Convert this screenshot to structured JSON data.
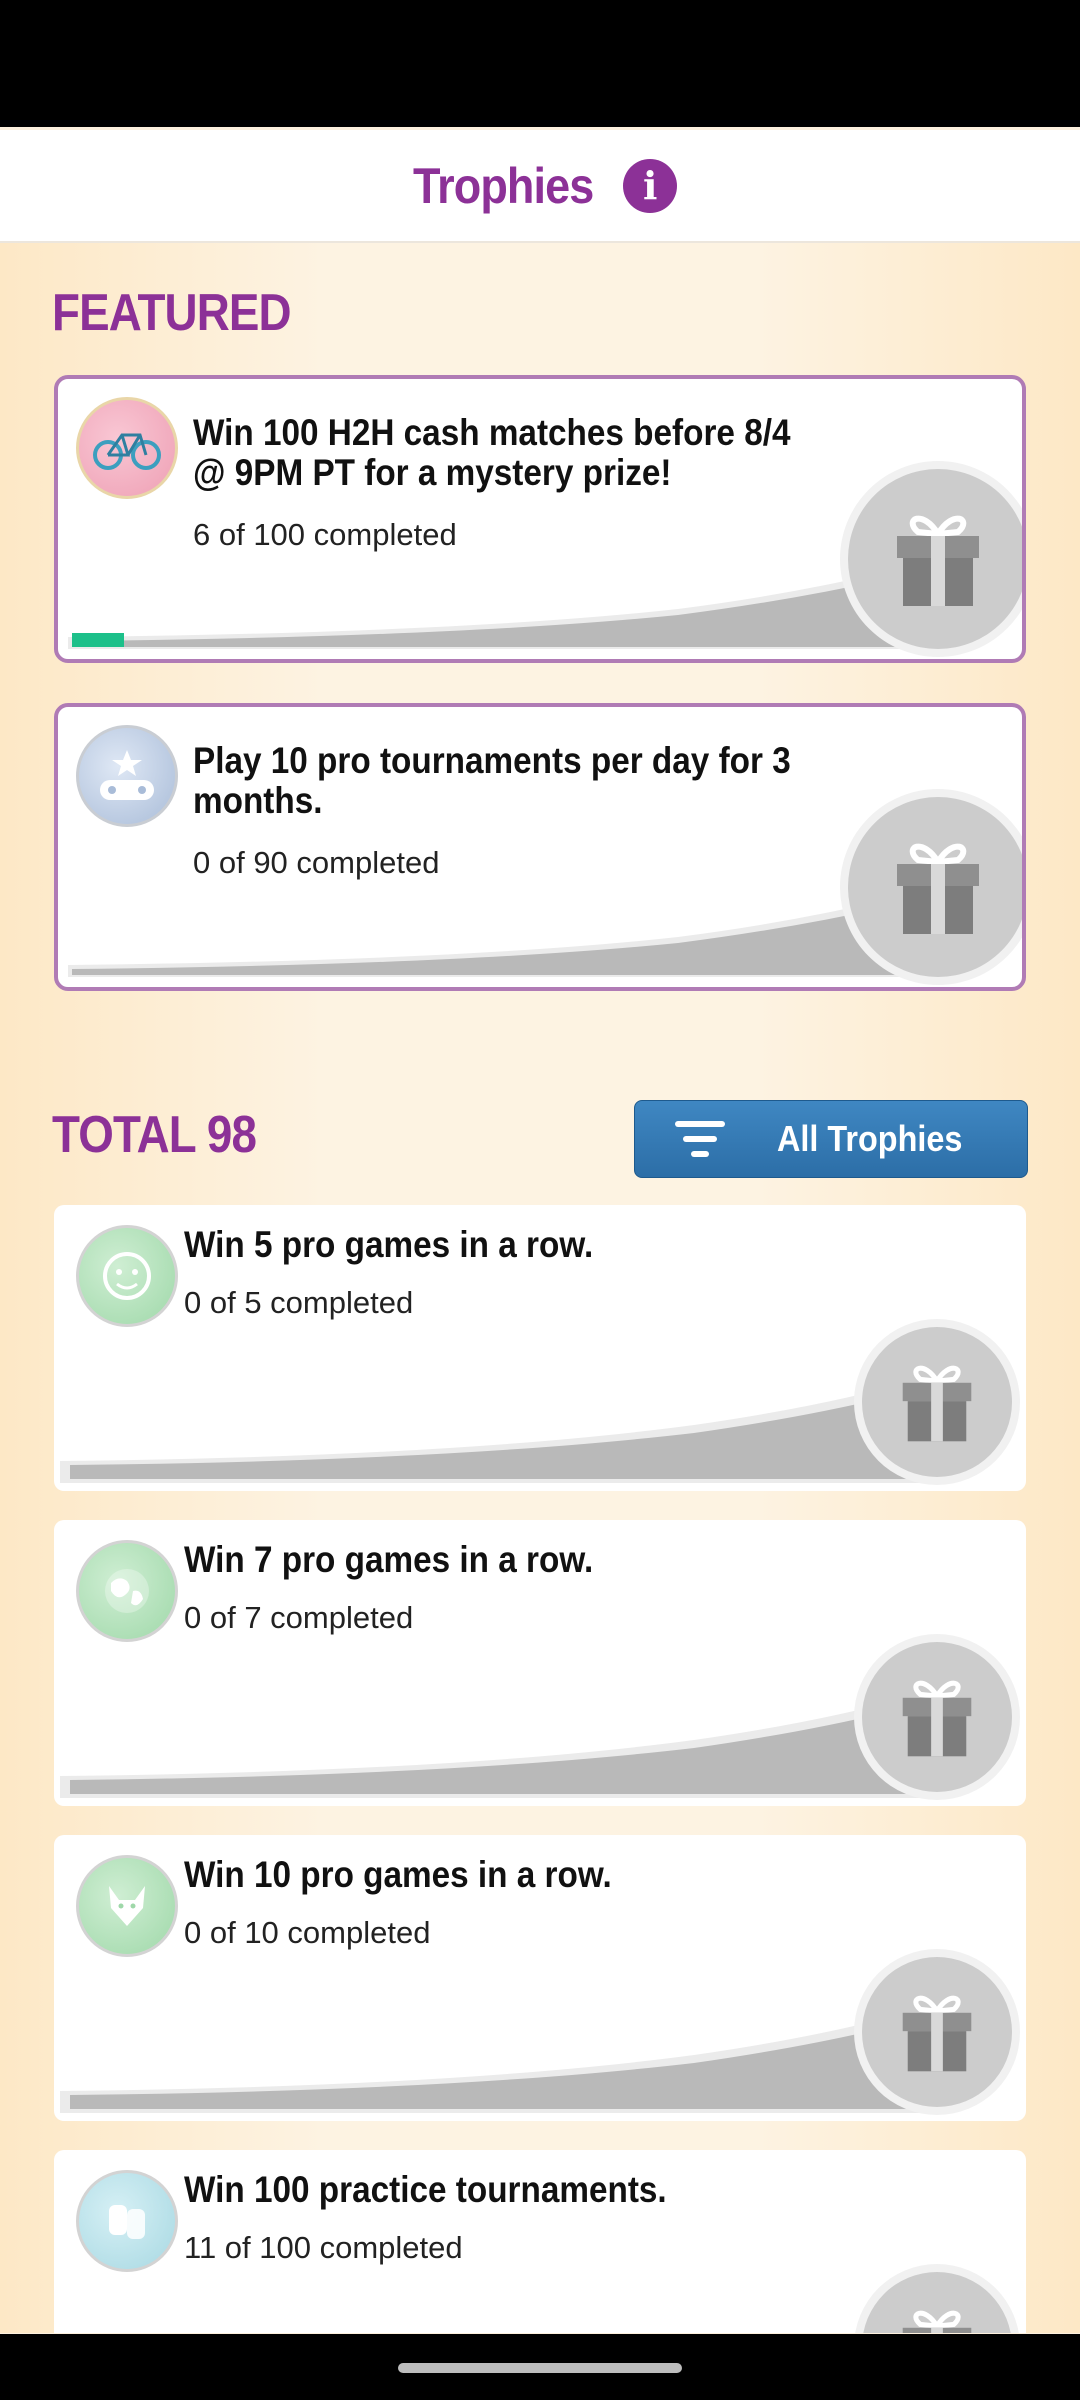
{
  "header": {
    "title": "Trophies"
  },
  "featured": {
    "heading": "FEATURED",
    "cards": [
      {
        "title_line1": "Win 100 H2H cash matches before 8/4",
        "title_line2": "@ 9PM PT for a mystery prize!",
        "progress": "6 of 100 completed",
        "completed": 6,
        "total": 100,
        "badge_icon": "bicycle-icon"
      },
      {
        "title_line1": "Play 10 pro tournaments per day for 3",
        "title_line2": "months.",
        "progress": "0 of 90 completed",
        "completed": 0,
        "total": 90,
        "badge_icon": "gamepad-star-icon"
      }
    ]
  },
  "total": {
    "heading": "TOTAL 98",
    "filter_label": "All Trophies",
    "cards": [
      {
        "title": "Win 5 pro games in a row.",
        "progress": "0 of 5 completed",
        "completed": 0,
        "total": 5,
        "badge_icon": "face-icon"
      },
      {
        "title": "Win 7 pro games in a row.",
        "progress": "0 of 7 completed",
        "completed": 0,
        "total": 7,
        "badge_icon": "globe-icon"
      },
      {
        "title": "Win 10 pro games in a row.",
        "progress": "0 of 10 completed",
        "completed": 0,
        "total": 10,
        "badge_icon": "wolf-icon"
      },
      {
        "title": "Win 100 practice tournaments.",
        "progress": "11 of 100 completed",
        "completed": 11,
        "total": 100,
        "badge_icon": "dog-tags-icon"
      }
    ]
  },
  "colors": {
    "brand_purple": "#8c3197",
    "progress_green": "#1dc08a",
    "button_blue": "#3279b5"
  }
}
